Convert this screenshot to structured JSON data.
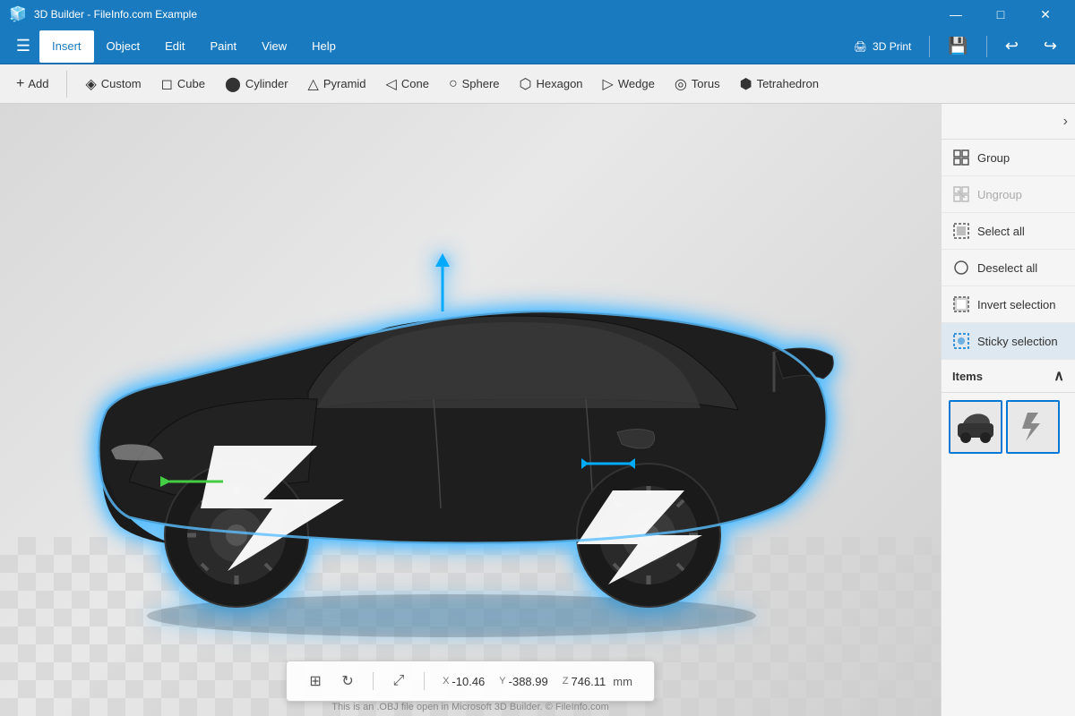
{
  "app": {
    "title": "3D Builder - FileInfo.com Example"
  },
  "titlebar": {
    "title": "3D Builder - FileInfo.com Example",
    "minimize": "—",
    "maximize": "□",
    "close": "✕"
  },
  "menubar": {
    "hamburger": "☰",
    "items": [
      {
        "label": "Insert",
        "active": true
      },
      {
        "label": "Object",
        "active": false
      },
      {
        "label": "Edit",
        "active": false
      },
      {
        "label": "Paint",
        "active": false
      },
      {
        "label": "View",
        "active": false
      },
      {
        "label": "Help",
        "active": false
      }
    ],
    "actions": [
      {
        "label": "3D Print",
        "icon": "🖨"
      },
      {
        "label": "💾"
      },
      {
        "label": "↩"
      },
      {
        "label": "↪"
      }
    ]
  },
  "toolbar": {
    "add_label": "+ Add",
    "items": [
      {
        "label": "Custom",
        "icon": "◈"
      },
      {
        "label": "Cube",
        "icon": "◻"
      },
      {
        "label": "Cylinder",
        "icon": "⬤"
      },
      {
        "label": "Pyramid",
        "icon": "△"
      },
      {
        "label": "Cone",
        "icon": "◁"
      },
      {
        "label": "Sphere",
        "icon": "○"
      },
      {
        "label": "Hexagon",
        "icon": "⬡"
      },
      {
        "label": "Wedge",
        "icon": "▷"
      },
      {
        "label": "Torus",
        "icon": "◎"
      },
      {
        "label": "Tetrahedron",
        "icon": "⬢"
      }
    ]
  },
  "right_panel": {
    "items": [
      {
        "label": "Group",
        "icon": "⊞",
        "disabled": false,
        "active": false
      },
      {
        "label": "Ungroup",
        "icon": "⊟",
        "disabled": true,
        "active": false
      },
      {
        "label": "Select all",
        "icon": "⊠",
        "disabled": false,
        "active": false
      },
      {
        "label": "Deselect all",
        "icon": "○",
        "disabled": false,
        "active": false
      },
      {
        "label": "Invert selection",
        "icon": "⊡",
        "disabled": false,
        "active": false
      },
      {
        "label": "Sticky selection",
        "icon": "⊡",
        "disabled": false,
        "active": true
      }
    ],
    "items_section": {
      "label": "Items",
      "collapse_icon": "∧",
      "items": [
        {
          "id": 1,
          "icon": "🚗"
        },
        {
          "id": 2,
          "icon": "🧊"
        }
      ]
    }
  },
  "statusbar": {
    "x_label": "X",
    "y_label": "Y",
    "z_label": "Z",
    "x_val": "-10.46",
    "y_val": "-388.99",
    "z_val": "746.11",
    "unit": "mm"
  },
  "footer": {
    "text": "This is an .OBJ file open in Microsoft 3D Builder. © FileInfo.com"
  }
}
